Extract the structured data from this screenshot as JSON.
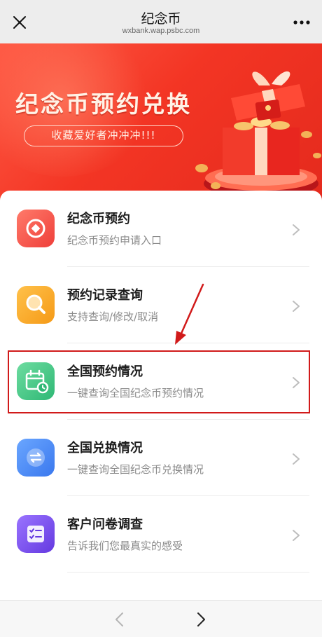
{
  "topbar": {
    "title": "纪念币",
    "url": "wxbank.wap.psbc.com"
  },
  "banner": {
    "headline": "纪念币预约兑换",
    "tagline": "收藏爱好者冲冲冲!!!"
  },
  "menu": {
    "items": [
      {
        "title": "纪念币预约",
        "subtitle": "纪念币预约申请入口",
        "icon": "coin-icon",
        "color": "#f0473d"
      },
      {
        "title": "预约记录查询",
        "subtitle": "支持查询/修改/取消",
        "icon": "magnifier-icon",
        "color": "#f6a21e"
      },
      {
        "title": "全国预约情况",
        "subtitle": "一键查询全国纪念币预约情况",
        "icon": "calendar-clock-icon",
        "color": "#3cc384"
      },
      {
        "title": "全国兑换情况",
        "subtitle": "一键查询全国纪念币兑换情况",
        "icon": "exchange-arrows-icon",
        "color": "#3f84f2"
      },
      {
        "title": "客户问卷调查",
        "subtitle": "告诉我们您最真实的感受",
        "icon": "checklist-icon",
        "color": "#6f47e6"
      }
    ]
  },
  "annotation": {
    "highlight_color": "#d11a1a"
  }
}
